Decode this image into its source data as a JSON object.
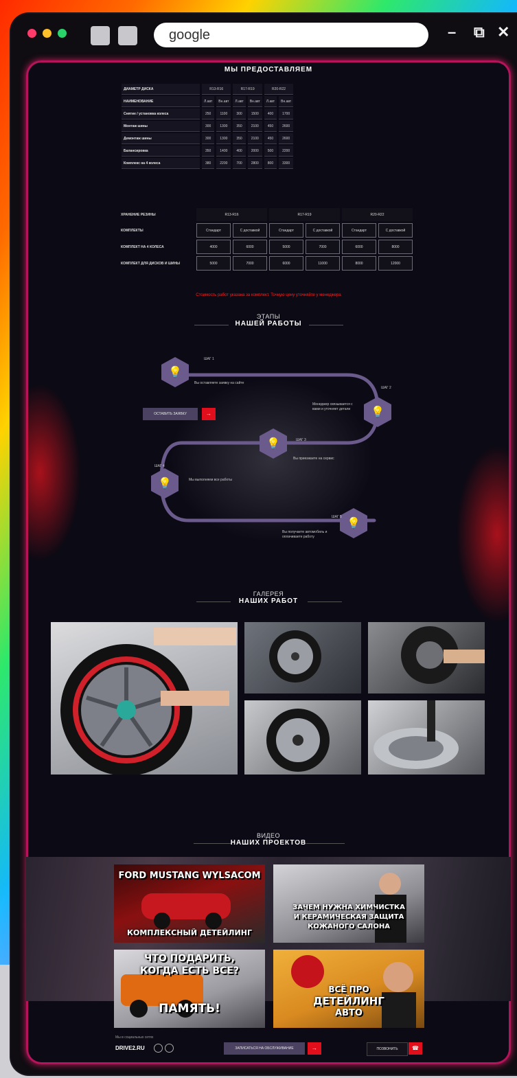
{
  "browser": {
    "address": "google",
    "controls": {
      "minimize": "–",
      "restore": "⧉",
      "close": "✕"
    }
  },
  "services": {
    "title": "МЫ ПРЕДОСТАВЛЯЕМ",
    "table1": {
      "header": [
        "ДИАМЕТР ДИСКА",
        "R13-R16",
        "R17-R19",
        "R20-R22"
      ],
      "subheader": [
        "НАИМЕНОВАНИЕ",
        "Л.авт",
        "Вн.авт",
        "Л.авт",
        "Вн.авт",
        "Л.авт",
        "Вн.авт"
      ],
      "rows": [
        {
          "label": "Снятие / установка колеса",
          "values": [
            "250",
            "1100",
            "300",
            "1500",
            "400",
            "1700"
          ]
        },
        {
          "label": "Монтаж шины",
          "values": [
            "300",
            "1300",
            "350",
            "2100",
            "450",
            "2600"
          ]
        },
        {
          "label": "Демонтаж шины",
          "values": [
            "300",
            "1300",
            "350",
            "2100",
            "450",
            "2600"
          ]
        },
        {
          "label": "Балансировка",
          "values": [
            "350",
            "1400",
            "400",
            "2000",
            "500",
            "2200"
          ]
        },
        {
          "label": "Комплекс на 4 колеса",
          "values": [
            "380",
            "2200",
            "700",
            "2800",
            "800",
            "3300"
          ]
        }
      ]
    },
    "table2": {
      "header": [
        "ХРАНЕНИЕ РЕЗИНЫ",
        "R13-R16",
        "R17-R19",
        "R20-R22"
      ],
      "rows": [
        {
          "label": "КОМПЛЕКТЫ",
          "values": [
            "Стандарт",
            "С доставкой",
            "Стандарт",
            "С доставкой",
            "Стандарт",
            "С доставкой"
          ]
        },
        {
          "label": "КОМПЛЕКТ НА 4 КОЛЕСА",
          "values": [
            "4000",
            "6000",
            "5000",
            "7000",
            "6000",
            "8000"
          ]
        },
        {
          "label": "КОМПЛЕКТ ДЛЯ ДИСКОВ И ШИНЫ",
          "values": [
            "5000",
            "7000",
            "6000",
            "11000",
            "8000",
            "12000"
          ]
        }
      ]
    },
    "note": "Стоимость работ указана за комплект. Точную цену уточняйте у менеджера"
  },
  "stages": {
    "small_title": "ЭТАПЫ",
    "big_title": "НАШЕЙ РАБОТЫ",
    "order_label": "ОСТАВИТЬ ЗАЯВКУ",
    "steps": [
      {
        "label": "ШАГ 1",
        "text": "Вы оставляете заявку на сайте"
      },
      {
        "label": "ШАГ 2",
        "text": "Менеджер связывается с вами и уточняет детали"
      },
      {
        "label": "ШАГ 3",
        "text": "Вы приезжаете на сервис"
      },
      {
        "label": "ШАГ 4",
        "text": "Мы выполняем все работы"
      },
      {
        "label": "ШАГ 5",
        "text": "Вы получаете автомобиль и оплачиваете работу"
      }
    ]
  },
  "gallery": {
    "small_title": "ГАЛЕРЕЯ",
    "big_title": "НАШИХ РАБОТ"
  },
  "videos": {
    "small_title": "ВИДЕО",
    "big_title": "НАШИХ ПРОЕКТОВ",
    "items": [
      {
        "line1": "FORD MUSTANG WYLSACOM",
        "line2": "КОМПЛЕКСНЫЙ ДЕТЕЙЛИНГ"
      },
      {
        "line1": "ЗАЧЕМ НУЖНА ХИМЧИСТКА",
        "line2": "И КЕРАМИЧЕСКАЯ ЗАЩИТА",
        "line3": "КОЖАНОГО САЛОНА"
      },
      {
        "line1": "ЧТО ПОДАРИТЬ,",
        "line2": "КОГДА ЕСТЬ ВСЕ?",
        "line3": "ПАМЯТЬ!"
      },
      {
        "line1": "ВСЁ ПРО",
        "line2": "ДЕТЕЙЛИНГ",
        "line3": "АВТО"
      }
    ]
  },
  "footer": {
    "small_text": "Мы в социальных сетях",
    "logo": "DRIVE2.RU",
    "cta_label": "ЗАПИСАТЬСЯ НА ОБСЛУЖИВАНИЕ",
    "call_label": "ПОЗВОНИТЬ"
  }
}
